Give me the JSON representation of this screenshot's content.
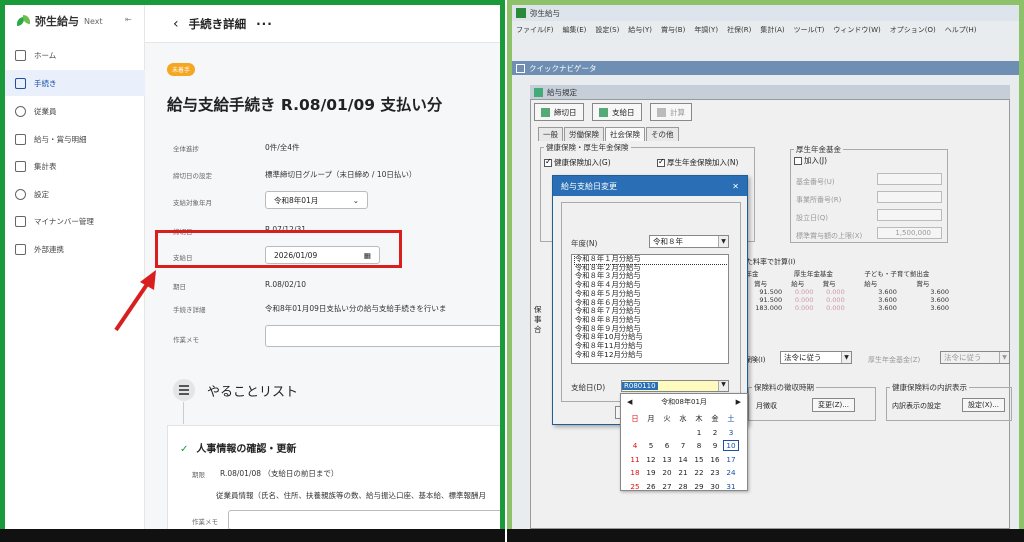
{
  "left": {
    "brand": "弥生給与",
    "brand_sub": "Next",
    "collapse": "⇤",
    "nav": [
      {
        "label": "ホーム",
        "icon": "home-icon"
      },
      {
        "label": "手続き",
        "icon": "procedure-icon"
      },
      {
        "label": "従業員",
        "icon": "person-icon"
      },
      {
        "label": "給与・賞与明細",
        "icon": "payslip-icon"
      },
      {
        "label": "集計表",
        "icon": "table-icon"
      },
      {
        "label": "設定",
        "icon": "gear-icon"
      },
      {
        "label": "マイナンバー管理",
        "icon": "mynumber-icon"
      },
      {
        "label": "外部連携",
        "icon": "link-icon"
      }
    ],
    "back": "‹",
    "page_header": "手続き詳細",
    "more": "···",
    "badge": "未着手",
    "title": "給与支給手続き R.08/01/09 支払い分",
    "fields": {
      "progress_label": "全体進捗",
      "progress_value": "0件/全4件",
      "closing_label": "締切日の設定",
      "closing_value": "標準締切日グループ（末日締め / 10日払い）",
      "month_label": "支給対象年月",
      "month_value": "令和8年01月",
      "month_arrow": "⌄",
      "deadline_label": "締切日",
      "deadline_value": "R.07/12/31",
      "payday_label": "支給日",
      "payday_value": "2026/01/09",
      "payday_icon": "▦",
      "due_label": "期日",
      "due_value": "R.08/02/10",
      "detail_label": "手続き詳細",
      "detail_value": "令和8年01月09日支払い分の給与支給手続きを行いま",
      "memo_label": "作業メモ"
    },
    "todo_title": "やることリスト",
    "card": {
      "check": "✓",
      "title": "人事情報の確認・更新",
      "due_label": "期限",
      "due_value": "R.08/01/08 （支給日の前日まで）",
      "desc": "従業員情報（氏名、住所、扶養親族等の数、給与振込口座、基本給、標準報酬月",
      "memo_label": "作業メモ"
    }
  },
  "right": {
    "window_title": "弥生給与",
    "menu": [
      "ファイル(F)",
      "編集(E)",
      "設定(S)",
      "給与(Y)",
      "賞与(B)",
      "年調(Y)",
      "社保(R)",
      "集計(A)",
      "ツール(T)",
      "ウィンドウ(W)",
      "オプション(O)",
      "ヘルプ(H)"
    ],
    "quicknav": "クイックナビゲータ",
    "child_title": "給与規定",
    "tool_buttons": [
      "締切日",
      "支給日",
      "計算"
    ],
    "tabs": [
      "一般",
      "労働保険",
      "社会保険",
      "その他"
    ],
    "group_health": "健康保険・厚生年金保険",
    "chk_health": "健康保険加入(G)",
    "chk_pension": "厚生年金保険加入(N)",
    "group_fund": "厚生年金基金",
    "chk_fund": "加入(J)",
    "fund_rows": [
      "基金番号(U)",
      "事業所番号(R)",
      "設立日(Q)",
      "標準賞与額の上限(X)"
    ],
    "fund_limit": "1,500,000",
    "calc_label": "した料率で計算(I)",
    "rate_headers": [
      "生年金",
      "厚生年金基金",
      "子ども・子育て拠出金"
    ],
    "rate_sub": [
      "賞与",
      "給与",
      "賞与",
      "給与",
      "賞与"
    ],
    "rate_rows": [
      [
        "91.500",
        "0.000",
        "0.000",
        "3.600",
        "3.600"
      ],
      [
        "91.500",
        "0.000",
        "0.000",
        "3.600",
        "3.600"
      ],
      [
        "183.000",
        "0.000",
        "0.000",
        "3.600",
        "3.600"
      ]
    ],
    "tail_cut": [
      "保",
      "事",
      "合"
    ],
    "hoken_label": "保険(I)",
    "hoken_value": "法令に従う",
    "fund_calc_label": "厚生年金基金(Z)",
    "fund_calc_value": "法令に従う",
    "collect_group": "保険料の徴収時期",
    "collect_text": "月徴収",
    "change_btn": "変更(Z)...",
    "display_group": "健康保険料の内訳表示",
    "display_text": "内訳表示の設定",
    "setting_btn": "設定(X)...",
    "dialog": {
      "title": "給与支給日変更",
      "close": "✕",
      "year_label": "年度(N)",
      "year_value": "令和８年",
      "list": [
        "令和８年１月分給与",
        "令和８年２月分給与",
        "令和８年３月分給与",
        "令和８年４月分給与",
        "令和８年５月分給与",
        "令和８年６月分給与",
        "令和８年７月分給与",
        "令和８年８月分給与",
        "令和８年９月分給与",
        "令和８年10月分給与",
        "令和８年11月分給与",
        "令和８年12月分給与"
      ],
      "payday_label": "支給日(D)",
      "payday_value": "R080110"
    },
    "calendar": {
      "prev": "◀",
      "month": "令和08年01月",
      "next": "▶",
      "weekdays": [
        "日",
        "月",
        "火",
        "水",
        "木",
        "金",
        "土"
      ],
      "days": [
        "",
        "",
        "",
        "",
        "1",
        "2",
        "3",
        "4",
        "5",
        "6",
        "7",
        "8",
        "9",
        "10",
        "11",
        "12",
        "13",
        "14",
        "15",
        "16",
        "17",
        "18",
        "19",
        "20",
        "21",
        "22",
        "23",
        "24",
        "25",
        "26",
        "27",
        "28",
        "29",
        "30",
        "31"
      ]
    }
  },
  "colors": {
    "left_frame": "#1a9a3a",
    "right_frame": "#8dc26a",
    "highlight": "#d91e1e",
    "accent": "#1b4fa8",
    "badge": "#f5a623"
  }
}
